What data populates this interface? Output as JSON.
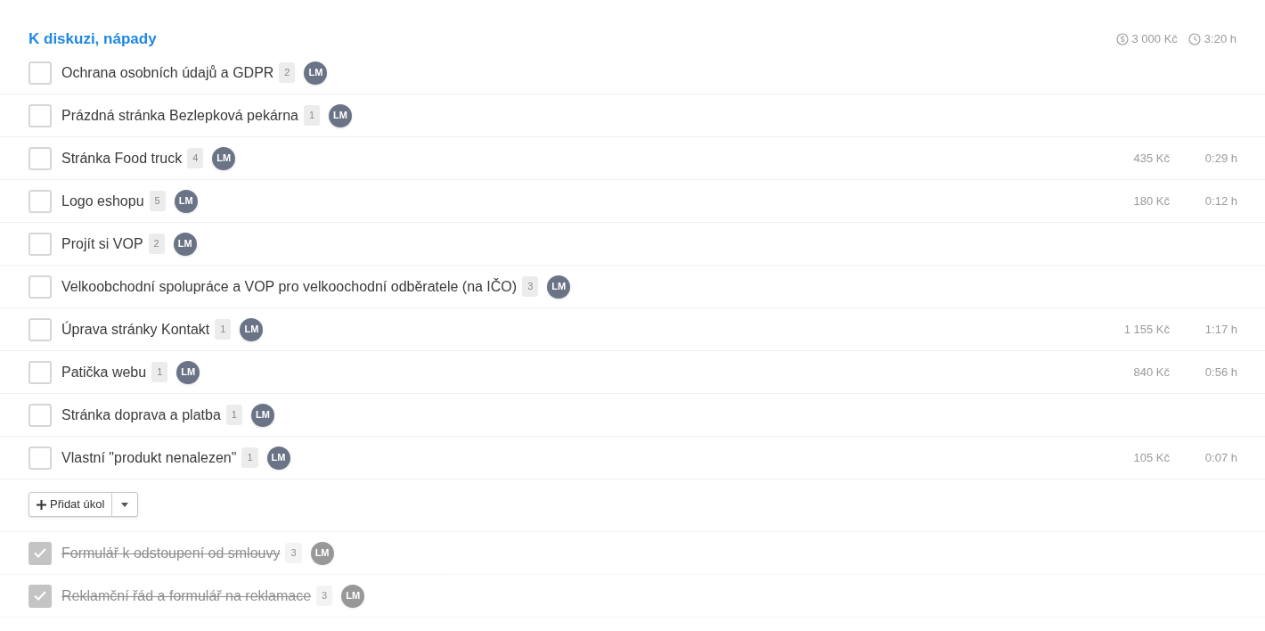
{
  "section": {
    "title": "K diskuzi, nápady",
    "total_cost": "3 000 Kč",
    "total_time": "3:20 h"
  },
  "tasks": [
    {
      "title": "Ochrana osobních údajů a GDPR",
      "count": "2",
      "assignee": "LM",
      "checked": false
    },
    {
      "title": "Prázdná stránka Bezlepková pekárna",
      "count": "1",
      "assignee": "LM",
      "checked": false
    },
    {
      "title": "Stránka Food truck",
      "count": "4",
      "assignee": "LM",
      "checked": false,
      "cost": "435 Kč",
      "time": "0:29 h"
    },
    {
      "title": "Logo eshopu",
      "count": "5",
      "assignee": "LM",
      "checked": false,
      "cost": "180 Kč",
      "time": "0:12 h"
    },
    {
      "title": "Projít si VOP",
      "count": "2",
      "assignee": "LM",
      "checked": false
    },
    {
      "title": "Velkoobchodní spolupráce a VOP pro velkoochodní odběratele (na IČO)",
      "count": "3",
      "assignee": "LM",
      "checked": false
    },
    {
      "title": "Úprava stránky Kontakt",
      "count": "1",
      "assignee": "LM",
      "checked": false,
      "cost": "1 155 Kč",
      "time": "1:17 h"
    },
    {
      "title": "Patička webu",
      "count": "1",
      "assignee": "LM",
      "checked": false,
      "cost": "840 Kč",
      "time": "0:56 h"
    },
    {
      "title": "Stránka doprava a platba",
      "count": "1",
      "assignee": "LM",
      "checked": false
    },
    {
      "title": "Vlastní \"produkt nenalezen\"",
      "count": "1",
      "assignee": "LM",
      "checked": false,
      "cost": "105 Kč",
      "time": "0:07 h"
    }
  ],
  "add_button": {
    "label": "Přidat úkol"
  },
  "done_tasks": [
    {
      "title": "Formulář k odstoupení od smlouvy",
      "count": "3",
      "assignee": "LM",
      "checked": true
    },
    {
      "title": "Reklamční řád a formulář na reklamace",
      "count": "3",
      "assignee": "LM",
      "checked": true
    }
  ]
}
